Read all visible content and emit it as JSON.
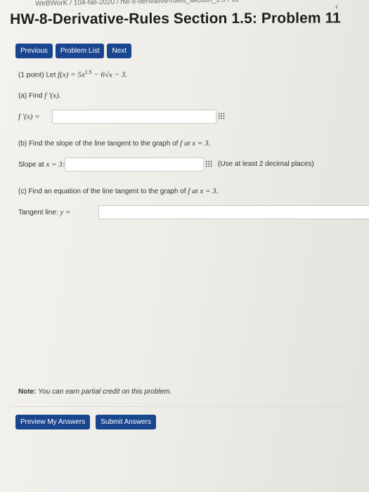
{
  "header": {
    "breadcrumb": "WeBWorK / 104-fall-2020 / hw-8-derivative-rules_section_1.5 / 11",
    "title": "HW-8-Derivative-Rules Section 1.5: Problem 11"
  },
  "nav": {
    "previous": "Previous",
    "problem_list": "Problem List",
    "next": "Next"
  },
  "problem": {
    "intro_prefix": "(1 point) Let ",
    "function_def": "f(x) = 5x",
    "exponent": "1.5",
    "function_rest": " − 6√x − 3.",
    "part_a": "(a) Find ",
    "part_a_math": "f ′(x).",
    "fprime_label": "f ′(x) =",
    "part_b_prefix": "(b) Find the slope of the line tangent to the graph of ",
    "part_b_math": "f at x = 3.",
    "slope_label_prefix": "Slope at ",
    "slope_label_math": "x = 3:",
    "slope_hint": "(Use at least 2 decimal places)",
    "part_c_prefix": "(c) Find an equation of the line tangent to the graph of ",
    "part_c_math": "f at x = 3.",
    "tangent_label": "Tangent line: ",
    "tangent_math": "y ="
  },
  "footer": {
    "note_label": "Note:",
    "note_text": " You can earn partial credit on this problem.",
    "preview": "Preview My Answers",
    "submit": "Submit Answers"
  }
}
